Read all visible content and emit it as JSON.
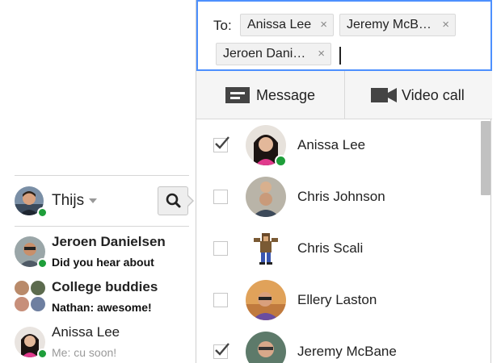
{
  "roster": {
    "me": {
      "name": "Thijs",
      "status": "online"
    },
    "conversations": [
      {
        "title": "Jeroen Danielsen",
        "snippet": "Did you hear about",
        "unread": true,
        "status": "online"
      },
      {
        "title": "College buddies",
        "snippet": "Nathan: awesome!",
        "unread": true,
        "status": "group"
      },
      {
        "title": "Anissa Lee",
        "snippet": "Me: cu soon!",
        "unread": false,
        "status": "online"
      }
    ]
  },
  "compose": {
    "to_label": "To:",
    "recipients": [
      {
        "label": "Anissa Lee",
        "remove_icon": "×"
      },
      {
        "label": "Jeremy McB…",
        "remove_icon": "×"
      },
      {
        "label": "Jeroen Dani…",
        "remove_icon": "×"
      }
    ],
    "actions": {
      "message": {
        "label": "Message",
        "icon": "message-icon"
      },
      "video": {
        "label": "Video call",
        "icon": "video-camera-icon"
      }
    },
    "contacts": [
      {
        "name": "Anissa Lee",
        "checked": true,
        "online": true
      },
      {
        "name": "Chris Johnson",
        "checked": false,
        "online": false
      },
      {
        "name": "Chris Scali",
        "checked": false,
        "online": false
      },
      {
        "name": "Ellery Laston",
        "checked": false,
        "online": false
      },
      {
        "name": "Jeremy McBane",
        "checked": true,
        "online": false
      }
    ]
  },
  "colors": {
    "online": "#1e9e3a",
    "focus_border": "#4d90fe",
    "chip_bg": "#f1f1f1"
  }
}
